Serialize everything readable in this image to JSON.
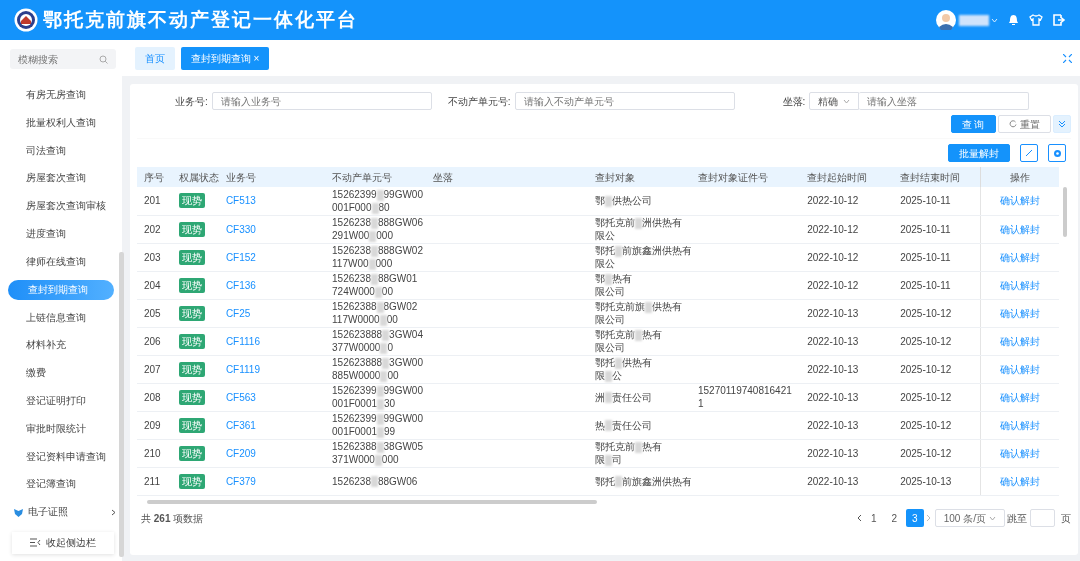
{
  "header": {
    "title": "鄂托克前旗不动产登记一体化平台"
  },
  "sidebar": {
    "search": {
      "placeholder": "模糊搜索"
    },
    "items": [
      {
        "label": "有房无房查询",
        "kind": "item",
        "selected": false
      },
      {
        "label": "批量权利人查询",
        "kind": "item",
        "selected": false
      },
      {
        "label": "司法查询",
        "kind": "item",
        "selected": false
      },
      {
        "label": "房屋套次查询",
        "kind": "item",
        "selected": false
      },
      {
        "label": "房屋套次查询审核",
        "kind": "item",
        "selected": false
      },
      {
        "label": "进度查询",
        "kind": "item",
        "selected": false
      },
      {
        "label": "律师在线查询",
        "kind": "item",
        "selected": false
      },
      {
        "label": "查封到期查询",
        "kind": "item",
        "selected": true
      },
      {
        "label": "上链信息查询",
        "kind": "item",
        "selected": false
      },
      {
        "label": "材料补充",
        "kind": "item",
        "selected": false
      },
      {
        "label": "缴费",
        "kind": "item",
        "selected": false
      },
      {
        "label": "登记证明打印",
        "kind": "item",
        "selected": false
      },
      {
        "label": "审批时限统计",
        "kind": "item",
        "selected": false
      },
      {
        "label": "登记资料申请查询",
        "kind": "item",
        "selected": false
      },
      {
        "label": "登记簿查询",
        "kind": "item",
        "selected": false
      },
      {
        "label": "电子证照",
        "kind": "group",
        "selected": false
      }
    ],
    "collapse": "收起侧边栏"
  },
  "tabs": [
    {
      "label": "首页",
      "selected": false
    },
    {
      "label": "查封到期查询",
      "close": "×",
      "selected": true
    }
  ],
  "filters": [
    {
      "label": "业务号:",
      "placeholder": "请输入业务号"
    },
    {
      "label": "不动产单元号:",
      "placeholder": "请输入不动产单元号"
    },
    {
      "label": "坐落:",
      "mode": "精确",
      "placeholder": "请输入坐落"
    }
  ],
  "buttons": {
    "query": "查 询",
    "reset": "重置",
    "batch": "批量解封"
  },
  "table": {
    "columns": [
      "序号",
      "权属状态",
      "业务号",
      "不动产单元号",
      "坐落",
      "查封对象",
      "查封对象证件号",
      "查封起始时间",
      "查封结束时间",
      "操作"
    ],
    "rows": [
      {
        "no": "201",
        "status": "现势",
        "biz": "CF513",
        "unit": [
          [
            "15262399",
            "99GW00"
          ],
          [
            "001F000",
            "80"
          ]
        ],
        "object": [
          [
            "鄂",
            "供热公司"
          ]
        ],
        "start": "2022-10-12",
        "end": "2025-10-11",
        "action": "确认解封"
      },
      {
        "no": "202",
        "status": "现势",
        "biz": "CF330",
        "unit": [
          [
            "1526238",
            "888GW06"
          ],
          [
            "291W00",
            "000"
          ]
        ],
        "object": [
          [
            "鄂托克前",
            "洲供热有"
          ],
          [
            "限公"
          ]
        ],
        "start": "2022-10-12",
        "end": "2025-10-11",
        "action": "确认解封"
      },
      {
        "no": "203",
        "status": "现势",
        "biz": "CF152",
        "unit": [
          [
            "1526238",
            "888GW02"
          ],
          [
            "117W00",
            "000"
          ]
        ],
        "object": [
          [
            "鄂托",
            "前旗鑫洲供热有"
          ],
          [
            "限公"
          ]
        ],
        "start": "2022-10-12",
        "end": "2025-10-11",
        "action": "确认解封"
      },
      {
        "no": "204",
        "status": "现势",
        "biz": "CF136",
        "unit": [
          [
            "1526238",
            "88GW01"
          ],
          [
            "724W000",
            "00"
          ]
        ],
        "object": [
          [
            "鄂",
            "热有"
          ],
          [
            "限公司"
          ]
        ],
        "start": "2022-10-12",
        "end": "2025-10-11",
        "action": "确认解封"
      },
      {
        "no": "205",
        "status": "现势",
        "biz": "CF25",
        "unit": [
          [
            "15262388",
            "8GW02"
          ],
          [
            "117W0000",
            "00"
          ]
        ],
        "object": [
          [
            "鄂托克前旗",
            "供热有"
          ],
          [
            "限公司"
          ]
        ],
        "start": "2022-10-13",
        "end": "2025-10-12",
        "action": "确认解封"
      },
      {
        "no": "206",
        "status": "现势",
        "biz": "CF1116",
        "unit": [
          [
            "152623888",
            "3GW04"
          ],
          [
            "377W0000",
            "0"
          ]
        ],
        "object": [
          [
            "鄂托克前",
            "热有"
          ],
          [
            "限公司"
          ]
        ],
        "start": "2022-10-13",
        "end": "2025-10-12",
        "action": "确认解封"
      },
      {
        "no": "207",
        "status": "现势",
        "biz": "CF1119",
        "unit": [
          [
            "152623888",
            "3GW00"
          ],
          [
            "885W0000",
            "00"
          ]
        ],
        "object": [
          [
            "鄂托",
            "供热有"
          ],
          [
            "限",
            "公"
          ]
        ],
        "start": "2022-10-13",
        "end": "2025-10-12",
        "action": "确认解封"
      },
      {
        "no": "208",
        "status": "现势",
        "biz": "CF563",
        "unit": [
          [
            "15262399",
            "99GW00"
          ],
          [
            "001F0001",
            "30"
          ]
        ],
        "object": [
          [
            "洲",
            "责任公司"
          ]
        ],
        "cert": [
          "15270119740816421",
          "1"
        ],
        "start": "2022-10-13",
        "end": "2025-10-12",
        "action": "确认解封"
      },
      {
        "no": "209",
        "status": "现势",
        "biz": "CF361",
        "unit": [
          [
            "15262399",
            "99GW00"
          ],
          [
            "001F0001",
            "99"
          ]
        ],
        "object": [
          [
            "热",
            "责任公司"
          ]
        ],
        "start": "2022-10-13",
        "end": "2025-10-12",
        "action": "确认解封"
      },
      {
        "no": "210",
        "status": "现势",
        "biz": "CF209",
        "unit": [
          [
            "15262388",
            "38GW05"
          ],
          [
            "371W000",
            "000"
          ]
        ],
        "object": [
          [
            "鄂托克前",
            "热有"
          ],
          [
            "限",
            "司"
          ]
        ],
        "start": "2022-10-13",
        "end": "2025-10-12",
        "action": "确认解封"
      },
      {
        "no": "211",
        "status": "现势",
        "biz": "CF379",
        "unit": [
          [
            "1526238",
            "88GW06"
          ]
        ],
        "object": [
          [
            "鄂托",
            "前旗鑫洲供热有"
          ]
        ],
        "start": "2022-10-13",
        "end": "2025-10-13",
        "action": "确认解封"
      }
    ]
  },
  "footer": {
    "total": "共 **261** 项数据",
    "pages": [
      {
        "label": "1",
        "selected": false
      },
      {
        "label": "2",
        "selected": false
      },
      {
        "label": "3",
        "selected": true
      }
    ],
    "page_size": "100 条/页",
    "jump": "跳至",
    "page_unit": "页"
  }
}
